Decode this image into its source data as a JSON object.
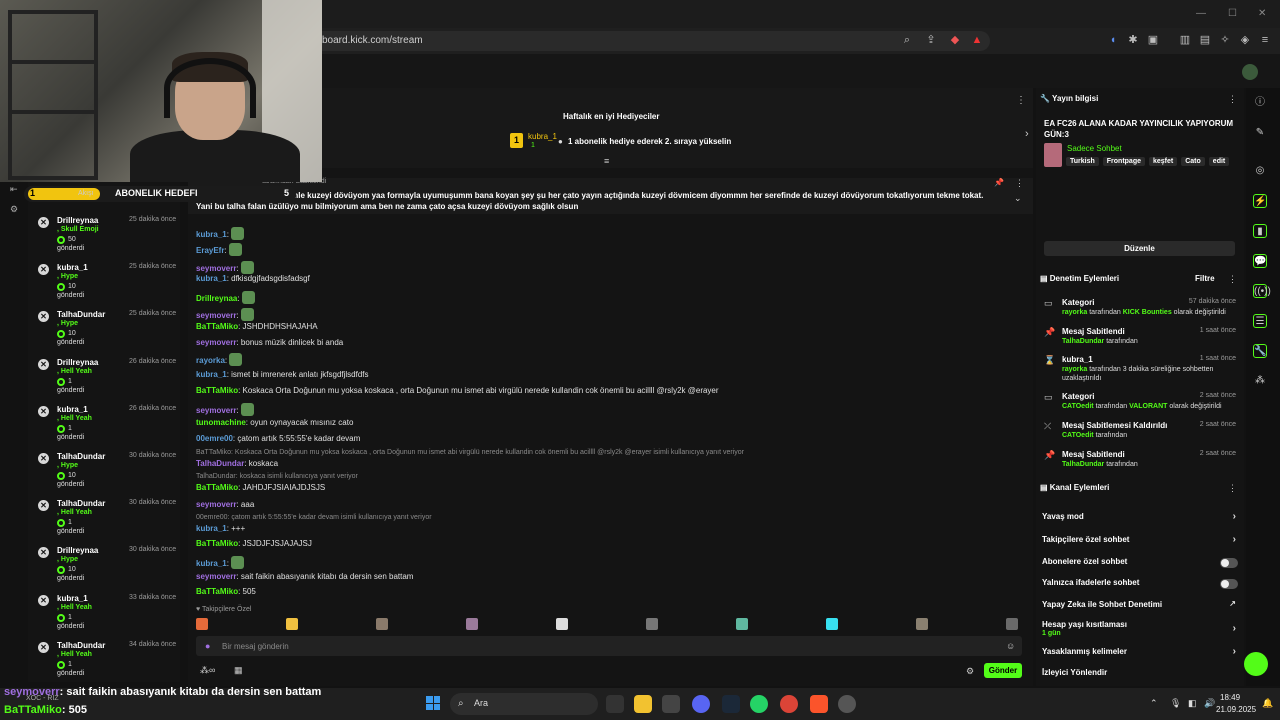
{
  "browser": {
    "url": "board.kick.com/stream"
  },
  "overlay": {
    "goal_label": "ABONELIK HEDEFI",
    "goal_count": "1",
    "goal_target": "5",
    "tab_akis": "Akışı",
    "caption_user1": "seymoverr",
    "caption_msg1": ": sait faikin abasıyanık kitabı da dersin sen battam",
    "caption_user2": "BaTTaMiko",
    "caption_msg2": ": 505",
    "badge": "XOC - RIZ"
  },
  "events": [
    {
      "name": "Drillreynaa",
      "time": "25 dakika önce",
      "type": ", Skull Emoji",
      "amount": "50",
      "sent": "gönderdi"
    },
    {
      "name": "kubra_1",
      "time": "25 dakika önce",
      "type": ", Hype",
      "amount": "10",
      "sent": "gönderdi"
    },
    {
      "name": "TalhaDundar",
      "time": "25 dakika önce",
      "type": ", Hype",
      "amount": "10",
      "sent": "gönderdi"
    },
    {
      "name": "Drillreynaa",
      "time": "26 dakika önce",
      "type": ", Hell Yeah",
      "amount": "1",
      "sent": "gönderdi"
    },
    {
      "name": "kubra_1",
      "time": "26 dakika önce",
      "type": ", Hell Yeah",
      "amount": "1",
      "sent": "gönderdi"
    },
    {
      "name": "TalhaDundar",
      "time": "30 dakika önce",
      "type": ", Hype",
      "amount": "10",
      "sent": "gönderdi"
    },
    {
      "name": "TalhaDundar",
      "time": "30 dakika önce",
      "type": ", Hell Yeah",
      "amount": "1",
      "sent": "gönderdi"
    },
    {
      "name": "Drillreynaa",
      "time": "30 dakika önce",
      "type": ", Hype",
      "amount": "10",
      "sent": "gönderdi"
    },
    {
      "name": "kubra_1",
      "time": "33 dakika önce",
      "type": ", Hell Yeah",
      "amount": "1",
      "sent": "gönderdi"
    },
    {
      "name": "TalhaDundar",
      "time": "34 dakika önce",
      "type": ", Hell Yeah",
      "amount": "1",
      "sent": "gönderdi"
    }
  ],
  "gifters": {
    "title": "Haftalık en iyi Hediyeciler",
    "top_user": "kubra_1",
    "top_count": "1",
    "rank": "1",
    "hint": "1 abonelik hediye ederek 2. sıraya yükselin"
  },
  "pinned": {
    "pinned_by": "tarafından Sabitlendi",
    "text": "kuzeyi dövmüşümm benimle kuzeyi dövüyom yaa formayla uyumuşumm bana koyan şey şu her çato yayın açtığında kuzeyi dövmicem diyommm her serefinde de kuzeyi dövüyorum tokatlıyorum tekme tokat. Yani bu talha falan üzülüyo mu bilmiyorum ama ben ne zama çato açsa kuzeyi dövüyom sağlık olsun"
  },
  "chat": [
    {
      "user": "kubra_1",
      "color": "#5b9bd5",
      "msg": ":"
    },
    {
      "user": "ErayEfr",
      "color": "#5b9bd5",
      "msg": ":"
    },
    {
      "user": "seymoverr",
      "color": "#a06fe0",
      "msg": ":"
    },
    {
      "user": "kubra_1",
      "color": "#5b9bd5",
      "msg": ": dfkisdgjfadsgdisfadsgf"
    },
    {
      "user": "Drillreynaa",
      "color": "#53fc18",
      "msg": ":"
    },
    {
      "user": "seymoverr",
      "color": "#a06fe0",
      "msg": ":"
    },
    {
      "user": "BaTTaMiko",
      "color": "#53fc18",
      "msg": ": JSHDHDHSHAJAHA"
    },
    {
      "user": "seymoverr",
      "color": "#a06fe0",
      "msg": ": bonus müzik dinlicek bi anda"
    },
    {
      "user": "rayorka",
      "color": "#5b9bd5",
      "msg": ":"
    },
    {
      "user": "kubra_1",
      "color": "#5b9bd5",
      "msg": ": ismet bi imrenerek anlatı jkfsgdfjlsdfdfs"
    },
    {
      "user": "BaTTaMiko",
      "color": "#53fc18",
      "msg": ": Koskaca Orta Doğunun mu yoksa koskaca , orta Doğunun mu ismet abi virgülü nerede kullandin cok önemli bu acillll @rsly2k @erayer"
    },
    {
      "user": "seymoverr",
      "color": "#a06fe0",
      "msg": ":"
    },
    {
      "user": "tunomachine",
      "color": "#53fc18",
      "msg": ": oyun oynayacak mısınız cato"
    },
    {
      "user": "00emre00",
      "color": "#5b9bd5",
      "msg": ": çatom artık 5:55:55'e kadar devam"
    },
    {
      "user": "TalhaDundar",
      "color": "#a06fe0",
      "msg": ": koskaca"
    },
    {
      "user": "BaTTaMiko",
      "color": "#53fc18",
      "msg": ": JAHDJFJSIAIAJDJSJS"
    },
    {
      "user": "seymoverr",
      "color": "#a06fe0",
      "msg": ": aaa"
    },
    {
      "user": "kubra_1",
      "color": "#5b9bd5",
      "msg": ": +++"
    },
    {
      "user": "BaTTaMiko",
      "color": "#53fc18",
      "msg": ": JSJDJFJSJAJAJSJ"
    },
    {
      "user": "kubra_1",
      "color": "#5b9bd5",
      "msg": ":"
    },
    {
      "user": "seymoverr",
      "color": "#a06fe0",
      "msg": ": sait faikin abasıyanık kitabı da dersin sen battam"
    },
    {
      "user": "BaTTaMiko",
      "color": "#53fc18",
      "msg": ": 505"
    }
  ],
  "replies": [
    "BaTTaMiko: Koskaca Orta Doğunun mu yoksa koskaca , orta Doğunun mu ismet abi virgülü nerede kullandin cok önemli bu acillll @rsly2k @erayer isimli kullanıcıya yanıt veriyor",
    "TalhaDundar: koskaca isimli kullanıcıya yanıt veriyor",
    "00emre00: çatom artık 5:55:55'e kadar devam isimli kullanıcıya yanıt veriyor"
  ],
  "followers_only": "Takipçilere Özel",
  "input": {
    "placeholder": "Bir mesaj gönderin",
    "send": "Gönder"
  },
  "stream_info": {
    "header": "Yayın bilgisi",
    "title": "EA FC26 ALANA KADAR YAYINCILIK YAPIYORUM GÜN:3",
    "category": "Sadece Sohbet",
    "tags": [
      "Turkish",
      "Frontpage",
      "keşfet",
      "Cato",
      "edit"
    ],
    "edit_button": "Düzenle"
  },
  "moderation": {
    "header": "Denetim Eylemleri",
    "filter": "Filtre",
    "items": [
      {
        "title": "Kategori",
        "time": "57 dakika önce",
        "actor": "rayorka",
        "mid": " tarafından ",
        "hl": "KICK Bounties",
        "tail": " olarak değiştirildi"
      },
      {
        "title": "Mesaj Sabitlendi",
        "time": "1 saat önce",
        "actor": "TalhaDundar",
        "mid": " tarafından",
        "hl": "",
        "tail": ""
      },
      {
        "title": "kubra_1",
        "time": "1 saat önce",
        "actor": "rayorka",
        "mid": " tarafından 3 dakika süreliğine sohbetten uzaklaştırıldı",
        "hl": "",
        "tail": ""
      },
      {
        "title": "Kategori",
        "time": "2 saat önce",
        "actor": "CATOedit",
        "mid": " tarafından ",
        "hl": "VALORANT",
        "tail": " olarak değiştirildi"
      },
      {
        "title": "Mesaj Sabitlemesi Kaldırıldı",
        "time": "2 saat önce",
        "actor": "CATOedit",
        "mid": " tarafından",
        "hl": "",
        "tail": ""
      },
      {
        "title": "Mesaj Sabitlendi",
        "time": "2 saat önce",
        "actor": "TalhaDundar",
        "mid": " tarafından",
        "hl": "",
        "tail": ""
      }
    ]
  },
  "channel": {
    "header": "Kanal Eylemleri",
    "slow": "Yavaş mod",
    "followers": "Takipçilere özel sohbet",
    "subs": "Abonelere özel sohbet",
    "emotes": "Yalnızca ifadelerle sohbet",
    "ai": "Yapay Zeka ile Sohbet Denetimi",
    "age": "Hesap yaşı kısıtlaması",
    "age_val": "1 gün",
    "banned": "Yasaklanmış kelimeler",
    "raid": "İzleyici Yönlendir"
  },
  "taskbar": {
    "search": "Ara",
    "time": "18:49",
    "date": "21.09.2025"
  }
}
